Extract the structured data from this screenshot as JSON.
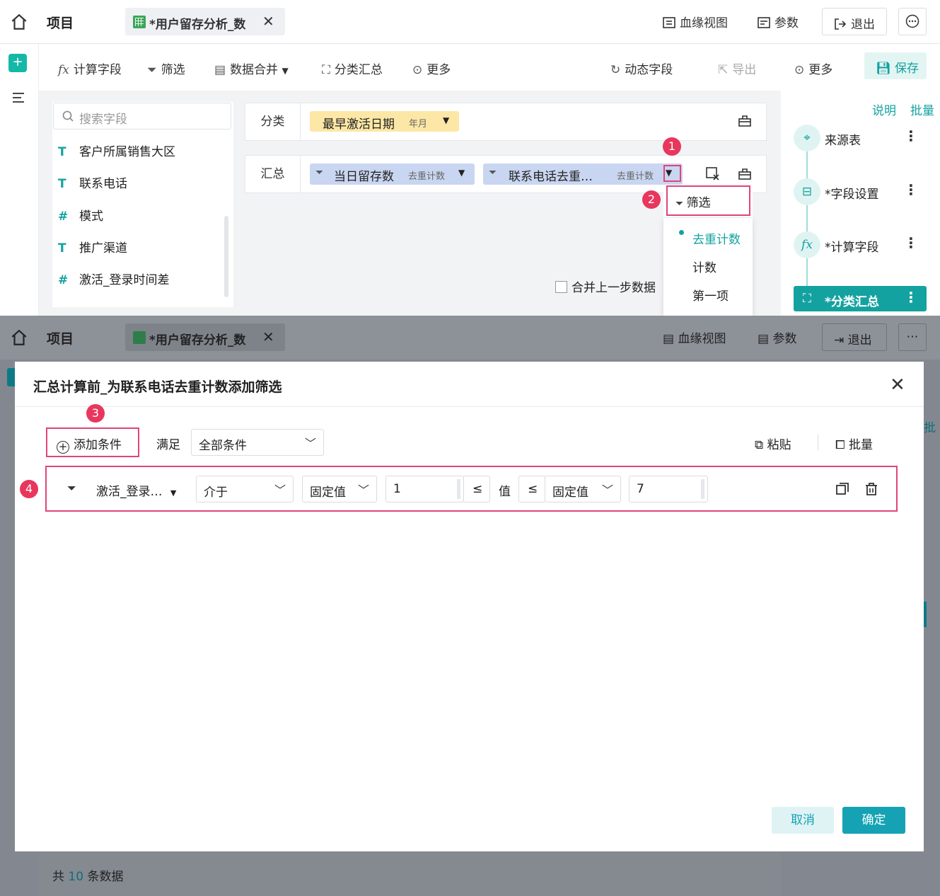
{
  "topbar": {
    "project": "项目",
    "tab_title": "*用户留存分析_数",
    "lineage": "血缘视图",
    "params": "参数",
    "exit": "退出"
  },
  "toolbar": {
    "calc_field": "计算字段",
    "filter": "筛选",
    "merge": "数据合并",
    "group_summary": "分类汇总",
    "more_left": "更多",
    "dynamic_field": "动态字段",
    "export": "导出",
    "more_right": "更多",
    "save": "保存"
  },
  "field_panel": {
    "search_placeholder": "搜索字段",
    "fields": [
      {
        "type": "T",
        "name": "客户所属销售大区"
      },
      {
        "type": "T",
        "name": "联系电话"
      },
      {
        "type": "#",
        "name": "模式"
      },
      {
        "type": "T",
        "name": "推广渠道"
      },
      {
        "type": "#",
        "name": "激活_登录时间差"
      }
    ]
  },
  "group_row": {
    "label": "分类",
    "chip": "最早激活日期",
    "chip_sub": "年月"
  },
  "summary_row": {
    "label": "汇总",
    "chip1": "当日留存数",
    "chip1_sub": "去重计数",
    "chip2": "联系电话去重…",
    "chip2_sub": "去重计数"
  },
  "merge_prev": "合并上一步数据",
  "dropdown": {
    "filter": "筛选",
    "items": [
      "去重计数",
      "计数",
      "第一项"
    ],
    "selected": "去重计数"
  },
  "right_panel": {
    "explain": "说明",
    "batch": "批量",
    "nodes": [
      "来源表",
      "*字段设置",
      "*计算字段",
      "*分类汇总"
    ]
  },
  "badges": [
    "1",
    "2",
    "3",
    "4"
  ],
  "modal": {
    "title": "汇总计算前_为联系电话去重计数添加筛选",
    "add_condition": "添加条件",
    "satisfy": "满足",
    "satisfy_value": "全部条件",
    "paste": "粘贴",
    "batch": "批量",
    "condition": {
      "field": "激活_登录…",
      "operator": "介于",
      "left_type": "固定值",
      "left_value": "1",
      "left_cmp": "≤",
      "value_label": "值",
      "right_cmp": "≤",
      "right_type": "固定值",
      "right_value": "7"
    },
    "cancel": "取消",
    "confirm": "确定"
  },
  "footer": {
    "total_prefix": "共",
    "total_count": "10",
    "total_suffix": "条数据"
  },
  "colors": {
    "accent": "#14a2a0",
    "badge": "#e8365d",
    "highlight_box": "#e0457b",
    "group_chip": "#fde7a6",
    "summary_chip": "#c9d6f1"
  }
}
